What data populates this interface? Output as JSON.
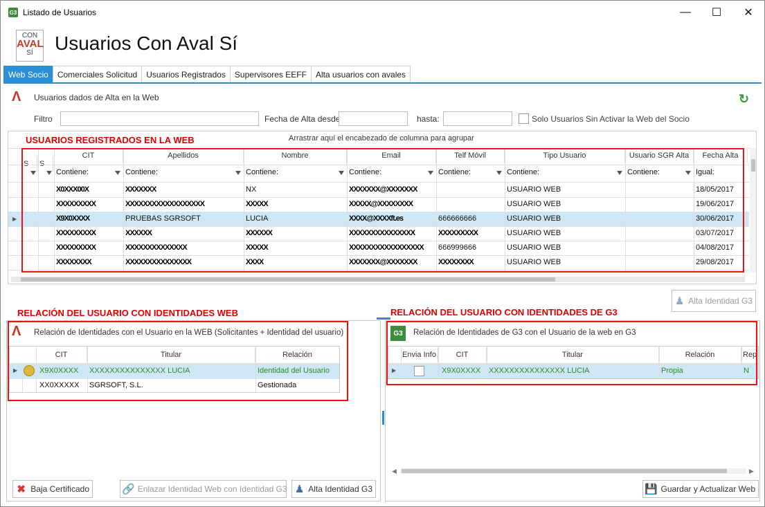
{
  "window": {
    "title": "Listado de Usuarios",
    "icon_text": "G3"
  },
  "header": {
    "title": "Usuarios Con Aval Sí",
    "logo_con": "CON",
    "logo_av": "AVAL",
    "logo_si": "SÍ"
  },
  "tabs": [
    "Web Socio",
    "Comerciales Solicitud",
    "Usuarios Registrados",
    "Supervisores EEFF",
    "Alta usuarios con avales"
  ],
  "active_tab": 0,
  "top_panel": {
    "title": "Usuarios dados de Alta en la Web",
    "filtro_label": "Filtro",
    "fecha_desde_label": "Fecha de Alta desde:",
    "hasta_label": "hasta:",
    "solo_label": "Solo Usuarios Sin Activar la Web del Socio",
    "group_hint": "Arrastrar aquí el encabezado de columna para agrupar",
    "annotation": "USUARIOS REGISTRADOS EN LA WEB"
  },
  "users_grid": {
    "columns": [
      "CIT",
      "Apellidos",
      "Nombre",
      "Email",
      "Telf Móvil",
      "Tipo Usuario",
      "Usuario SGR Alta",
      "Fecha Alta"
    ],
    "filters": [
      "Contiene:",
      "Contiene:",
      "Contiene:",
      "Contiene:",
      "Contiene:",
      "Contiene:",
      "Contiene:",
      "Igual:"
    ],
    "small_cols": [
      "S",
      "S"
    ],
    "rows": [
      {
        "cit": "X0XXX00X",
        "apellidos": "XXXXXXX",
        "nombre": "NX",
        "email": "XXXXXXX@XXXXXXX",
        "telf": "",
        "tipo": "USUARIO WEB",
        "sgr": "",
        "fecha": "18/05/2017"
      },
      {
        "cit": "XXXXXXXXX",
        "apellidos": "XXXXXXXXXXXXXXXXXX",
        "nombre": "XXXXX",
        "email": "XXXXX@XXXXXXXX",
        "telf": "",
        "tipo": "USUARIO WEB",
        "sgr": "",
        "fecha": "19/06/2017"
      },
      {
        "cit": "X9X0XXXX",
        "apellidos": "PRUEBAS SGRSOFT",
        "nombre": "LUCIA",
        "email": "XXXX@XXXXft.es",
        "telf": "666666666",
        "tipo": "USUARIO WEB",
        "sgr": "",
        "fecha": "30/06/2017"
      },
      {
        "cit": "XXXXXXXXX",
        "apellidos": "XXXXXX",
        "nombre": "XXXXXX",
        "email": "XXXXXXXXXXXXXXX",
        "telf": "XXXXXXXXX",
        "tipo": "USUARIO WEB",
        "sgr": "",
        "fecha": "03/07/2017"
      },
      {
        "cit": "XXXXXXXXX",
        "apellidos": "XXXXXXXXXXXXXX",
        "nombre": "XXXXX",
        "email": "XXXXXXXXXXXXXXXXX",
        "telf": "666999666",
        "tipo": "USUARIO WEB",
        "sgr": "",
        "fecha": "04/08/2017"
      },
      {
        "cit": "XXXXXXXX",
        "apellidos": "XXXXXXXXXXXXXXX",
        "nombre": "XXXX",
        "email": "XXXXXXX@XXXXXXX",
        "telf": "XXXXXXXX",
        "tipo": "USUARIO WEB",
        "sgr": "",
        "fecha": "29/08/2017"
      }
    ],
    "selected_row": 2
  },
  "alta_identidad_top": "Alta Identidad G3",
  "left_panel": {
    "annotation": "RELACIÓN DEL USUARIO CON IDENTIDADES WEB",
    "title": "Relación de Identidades con el Usuario en la WEB (Solicitantes + Identidad del usuario)",
    "columns": [
      "CIT",
      "Titular",
      "Relación"
    ],
    "rows": [
      {
        "cit": "X9X0XXXX",
        "titular": "XXXXXXXXXXXXXXX LUCIA",
        "relacion": "Identidad del Usuario"
      },
      {
        "cit": "XX0XXXXX",
        "titular": "SGRSOFT, S.L.",
        "relacion": "Gestionada"
      }
    ]
  },
  "right_panel": {
    "annotation": "RELACIÓN DEL USUARIO CON IDENTIDADES DE G3",
    "title": "Relación de Identidades de G3 con el Usuario de la web en G3",
    "columns": [
      "Envia Info",
      "CIT",
      "Titular",
      "Relación",
      "Rep"
    ],
    "rows": [
      {
        "cit": "X9X0XXXX",
        "titular": "XXXXXXXXXXXXXXX LUCIA",
        "relacion": "Propia",
        "rep": "N"
      }
    ]
  },
  "buttons": {
    "baja": "Baja Certificado",
    "enlazar": "Enlazar Identidad Web con Identidad G3",
    "alta": "Alta Identidad G3",
    "guardar": "Guardar y Actualizar Web"
  },
  "colors": {
    "accent": "#2b8fd6",
    "annotation": "#e00000",
    "selected_row": "#cfe6f5",
    "green_text": "#2a8a2a"
  }
}
